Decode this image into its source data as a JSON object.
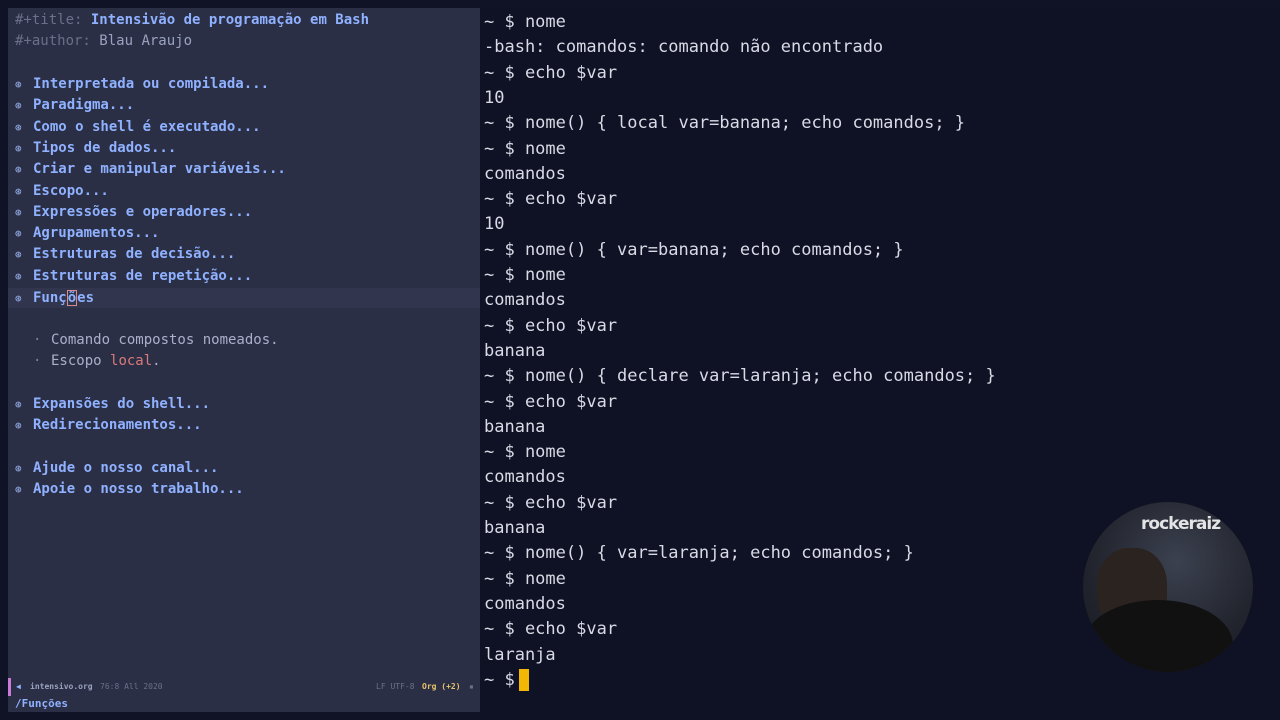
{
  "editor": {
    "title_key": "#+title:",
    "title_value": "Intensivão de programação em Bash",
    "author_key": "#+author:",
    "author_value": "Blau Araujo",
    "bullet_glyph": "⊛",
    "headings_a": [
      "Interpretada ou compilada...",
      "Paradigma...",
      "Como o shell é executado...",
      "Tipos de dados...",
      "Criar e manipular variáveis...",
      "Escopo...",
      "Expressões e operadores...",
      "Agrupamentos...",
      "Estruturas de decisão...",
      "Estruturas de repetição..."
    ],
    "current_heading_pre": "Funç",
    "current_heading_cursor": "õ",
    "current_heading_post": "es",
    "sub_dot": "·",
    "sub1": "Comando compostos nomeados.",
    "sub2_pre": "Escopo ",
    "sub2_local": "local",
    "sub2_post": ".",
    "headings_b": [
      "Expansões do shell...",
      "Redirecionamentos..."
    ],
    "headings_c": [
      "Ajude o nosso canal...",
      "Apoie o nosso trabalho..."
    ],
    "modeline": {
      "buffer": "intensivo.org",
      "position": "76:8 All 2020",
      "encoding": "LF UTF-8",
      "mode": "Org (+2)"
    },
    "echo_area": "/Funções"
  },
  "terminal": {
    "lines": [
      "~ $ nome",
      "-bash: comandos: comando não encontrado",
      "~ $ echo $var",
      "10",
      "~ $ nome() { local var=banana; echo comandos; }",
      "~ $ nome",
      "comandos",
      "~ $ echo $var",
      "10",
      "~ $ nome() { var=banana; echo comandos; }",
      "~ $ nome",
      "comandos",
      "~ $ echo $var",
      "banana",
      "~ $ nome() { declare var=laranja; echo comandos; }",
      "~ $ echo $var",
      "banana",
      "~ $ nome",
      "comandos",
      "~ $ echo $var",
      "banana",
      "~ $ nome() { var=laranja; echo comandos; }",
      "~ $ nome",
      "comandos",
      "~ $ echo $var",
      "laranja"
    ],
    "prompt": "~ $"
  },
  "webcam": {
    "logo_text": "rockeraiz"
  },
  "colors": {
    "accent": "#8fb1ff",
    "cursor": "#f2b705",
    "local_keyword": "#d97a7a"
  }
}
